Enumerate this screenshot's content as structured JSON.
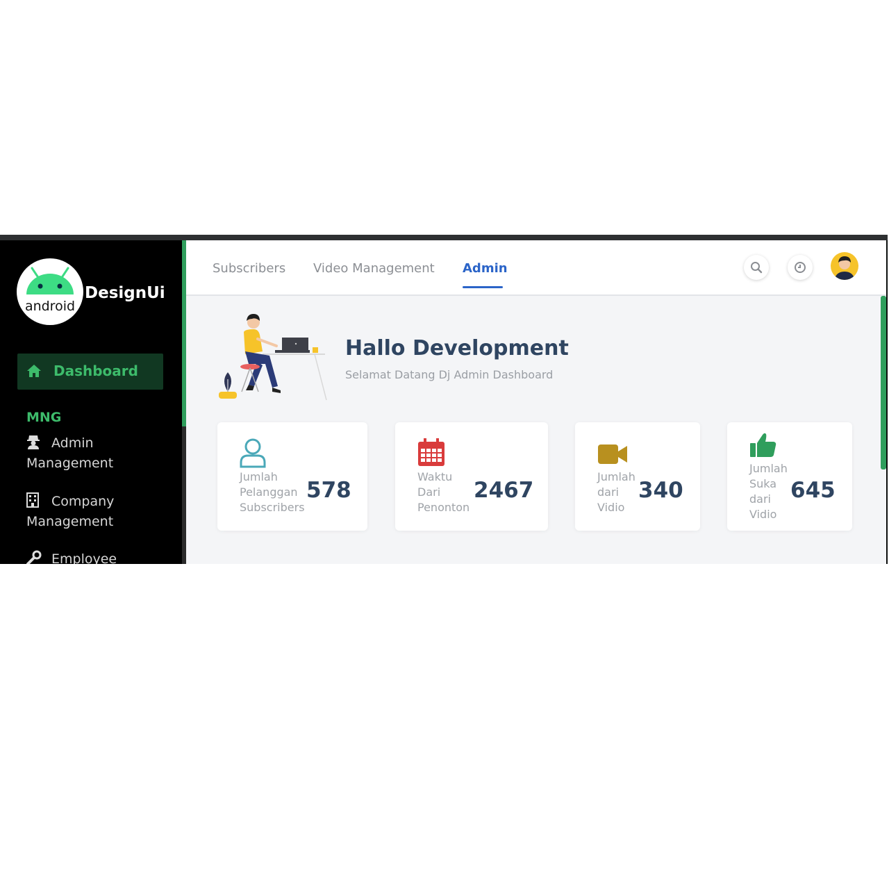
{
  "brand": {
    "logo_text": "android",
    "name": "DesignUi"
  },
  "sidebar": {
    "active": {
      "label": "Dashboard",
      "icon": "home-icon"
    },
    "section": "MNG",
    "items": [
      {
        "line1": "Admin",
        "line2": "Management",
        "icon": "user-secret-icon"
      },
      {
        "line1": "Company",
        "line2": "Management",
        "icon": "building-icon"
      },
      {
        "line1": "Employee",
        "icon": "wrench-icon"
      }
    ]
  },
  "header": {
    "tabs": [
      {
        "label": "Subscribers"
      },
      {
        "label": "Video Management"
      },
      {
        "label": "Admin"
      }
    ],
    "active_tab": "Admin",
    "icons": [
      "search-icon",
      "clock-icon",
      "avatar"
    ]
  },
  "hero": {
    "title": "Hallo Development",
    "subtitle": "Selamat Datang Dj Admin Dashboard"
  },
  "cards": [
    {
      "l1": "Jumlah",
      "l2": "Pelanggan",
      "l3": "Subscribers",
      "value": "578",
      "icon": "user-outline-icon",
      "color": "#4aa8b8"
    },
    {
      "l1": "Waktu",
      "l2": "Dari",
      "l3": "Penonton",
      "value": "2467",
      "icon": "calendar-icon",
      "color": "#d93b3b"
    },
    {
      "l1": "Jumlah",
      "l2": "dari",
      "l3": "Vidio",
      "value": "340",
      "icon": "video-camera-icon",
      "color": "#b8901f"
    },
    {
      "l1": "Jumlah",
      "l2": "Suka",
      "l3": "dari",
      "l4": "Vidio",
      "value": "645",
      "icon": "thumbs-up-icon",
      "color": "#2f9e5c"
    }
  ],
  "colors": {
    "accent_green": "#3dbb6b",
    "accent_blue": "#2b64c8",
    "title_navy": "#2f4561"
  }
}
